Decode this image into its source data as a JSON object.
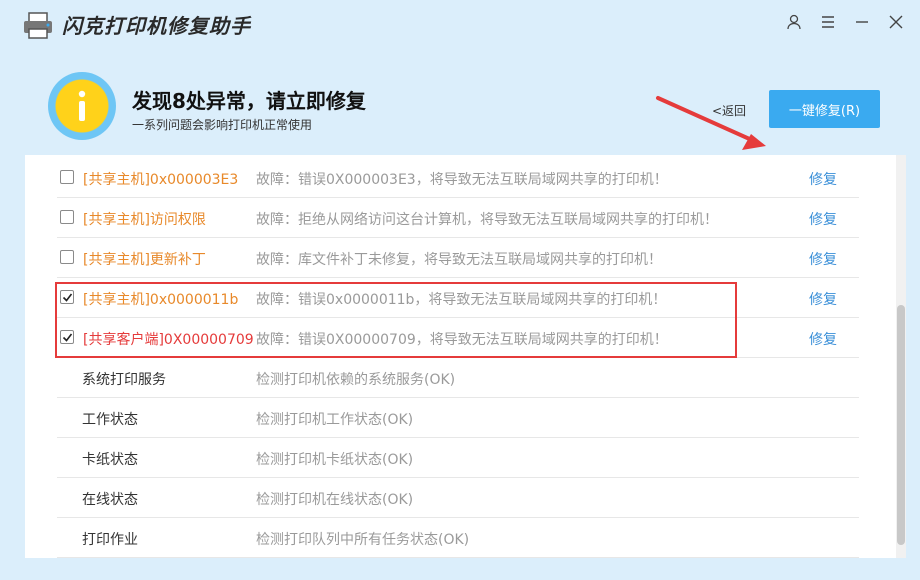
{
  "app": {
    "title": "闪克打印机修复助手"
  },
  "header": {
    "headline": "发现8处异常，请立即修复",
    "subline": "一系列问题会影响打印机正常使用",
    "back_label": "<返回",
    "fix_all_label": "一键修复(R)"
  },
  "issues": [
    {
      "name": "[共享主机]0x000003E3",
      "desc": "故障：错误0X000003E3，将导致无法互联局域网共享的打印机！",
      "fix": "修复",
      "checked": false,
      "color": "orange"
    },
    {
      "name": "[共享主机]访问权限",
      "desc": "故障：拒绝从网络访问这台计算机，将导致无法互联局域网共享的打印机！",
      "fix": "修复",
      "checked": false,
      "color": "orange"
    },
    {
      "name": "[共享主机]更新补丁",
      "desc": "故障：库文件补丁未修复，将导致无法互联局域网共享的打印机！",
      "fix": "修复",
      "checked": false,
      "color": "orange"
    },
    {
      "name": "[共享主机]0x0000011b",
      "desc": "故障：错误0x0000011b，将导致无法互联局域网共享的打印机！",
      "fix": "修复",
      "checked": true,
      "color": "orange"
    },
    {
      "name": "[共享客户端]0X00000709",
      "desc": "故障：错误0X00000709，将导致无法互联局域网共享的打印机！",
      "fix": "修复",
      "checked": true,
      "color": "red"
    }
  ],
  "checks": [
    {
      "name": "系统打印服务",
      "desc": "检测打印机依赖的系统服务(OK)"
    },
    {
      "name": "工作状态",
      "desc": "检测打印机工作状态(OK)"
    },
    {
      "name": "卡纸状态",
      "desc": "检测打印机卡纸状态(OK)"
    },
    {
      "name": "在线状态",
      "desc": "检测打印机在线状态(OK)"
    },
    {
      "name": "打印作业",
      "desc": "检测打印队列中所有任务状态(OK)"
    }
  ],
  "colors": {
    "accent": "#3aaaf0",
    "warning_orange": "#e8892a",
    "error_red": "#e53b3b",
    "link_blue": "#3a8fd8",
    "alert_yellow": "#ffd21a"
  },
  "icons": {
    "app": "printer-icon",
    "user": "user-icon",
    "menu": "menu-icon",
    "minimize": "minimize-icon",
    "close": "close-icon",
    "alert": "info-icon"
  }
}
